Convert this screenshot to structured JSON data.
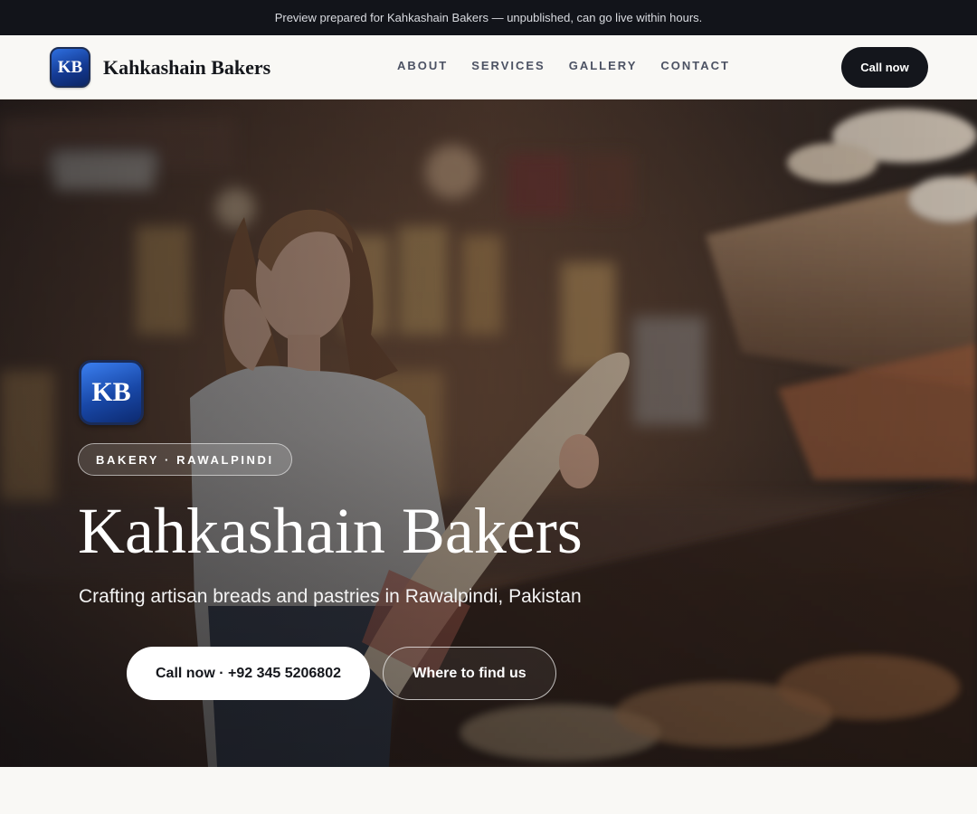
{
  "announcement": "Preview prepared for Kahkashain Bakers — unpublished, can go live within hours.",
  "header": {
    "logo_text": "KB",
    "brand_name": "Kahkashain Bakers",
    "nav": [
      "ABOUT",
      "SERVICES",
      "GALLERY",
      "CONTACT"
    ],
    "call_label": "Call now"
  },
  "hero": {
    "logo_text": "KB",
    "tag": "BAKERY · RAWALPINDI",
    "title": "Kahkashain Bakers",
    "subtitle": "Crafting artisan breads and pastries in Rawalpindi, Pakistan",
    "primary_button": "Call now · +92 345 5206802",
    "secondary_button": "Where to find us"
  },
  "colors": {
    "dark": "#14161c",
    "logo_blue": "#1847a6",
    "page_bg": "#f9f8f5"
  }
}
